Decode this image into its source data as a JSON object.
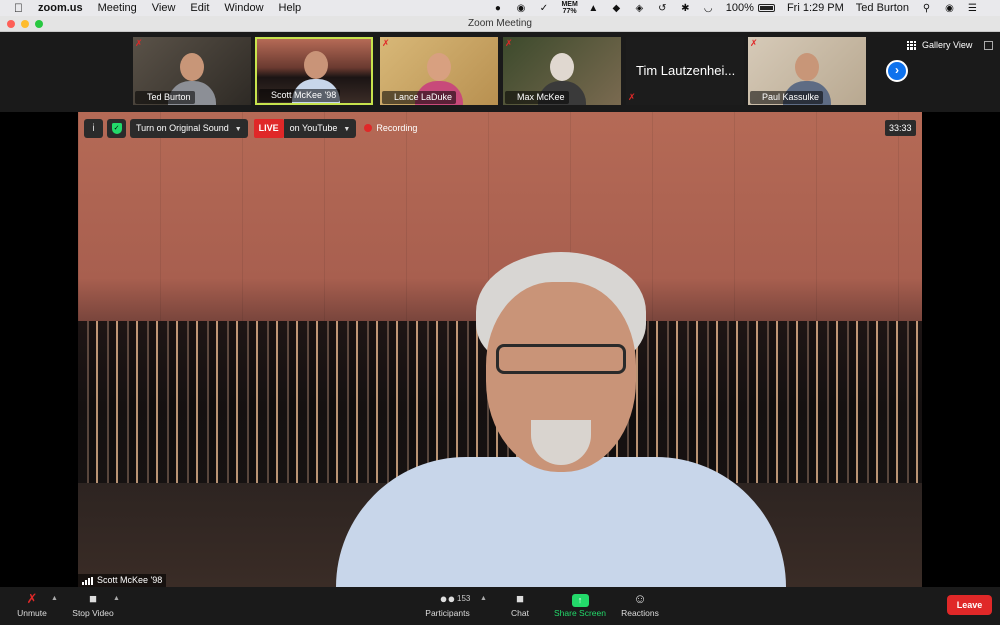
{
  "menubar": {
    "apple_icon": "apple-icon",
    "app_name": "zoom.us",
    "menus": [
      "Meeting",
      "View",
      "Edit",
      "Window",
      "Help"
    ],
    "mem_label": "MEM",
    "mem_value": "77%",
    "battery": "100%",
    "clock": "Fri 1:29 PM",
    "user": "Ted Burton"
  },
  "window": {
    "title": "Zoom Meeting"
  },
  "gallery_strip": {
    "tiles": [
      {
        "name": "Ted Burton"
      },
      {
        "name": "Scott McKee '98"
      },
      {
        "name": "Lance LaDuke"
      },
      {
        "name": "Max McKee"
      },
      {
        "name": "Tim Lautzenhei..."
      },
      {
        "name": "Paul Kassulke"
      }
    ],
    "gallery_view_label": "Gallery View"
  },
  "main_video": {
    "original_sound_label": "Turn on Original Sound",
    "live_label": "LIVE",
    "youtube_label": "on YouTube",
    "recording_label": "Recording",
    "timer": "33:33",
    "speaker_name": "Scott McKee '98"
  },
  "toolbar": {
    "unmute": "Unmute",
    "stop_video": "Stop Video",
    "participants": "Participants",
    "participant_count": "153",
    "chat": "Chat",
    "share_screen": "Share Screen",
    "reactions": "Reactions",
    "leave": "Leave"
  },
  "colors": {
    "accent_blue": "#0e72ed",
    "live_red": "#e02828",
    "share_green": "#23d96a",
    "active_speaker": "#c7e34d"
  }
}
